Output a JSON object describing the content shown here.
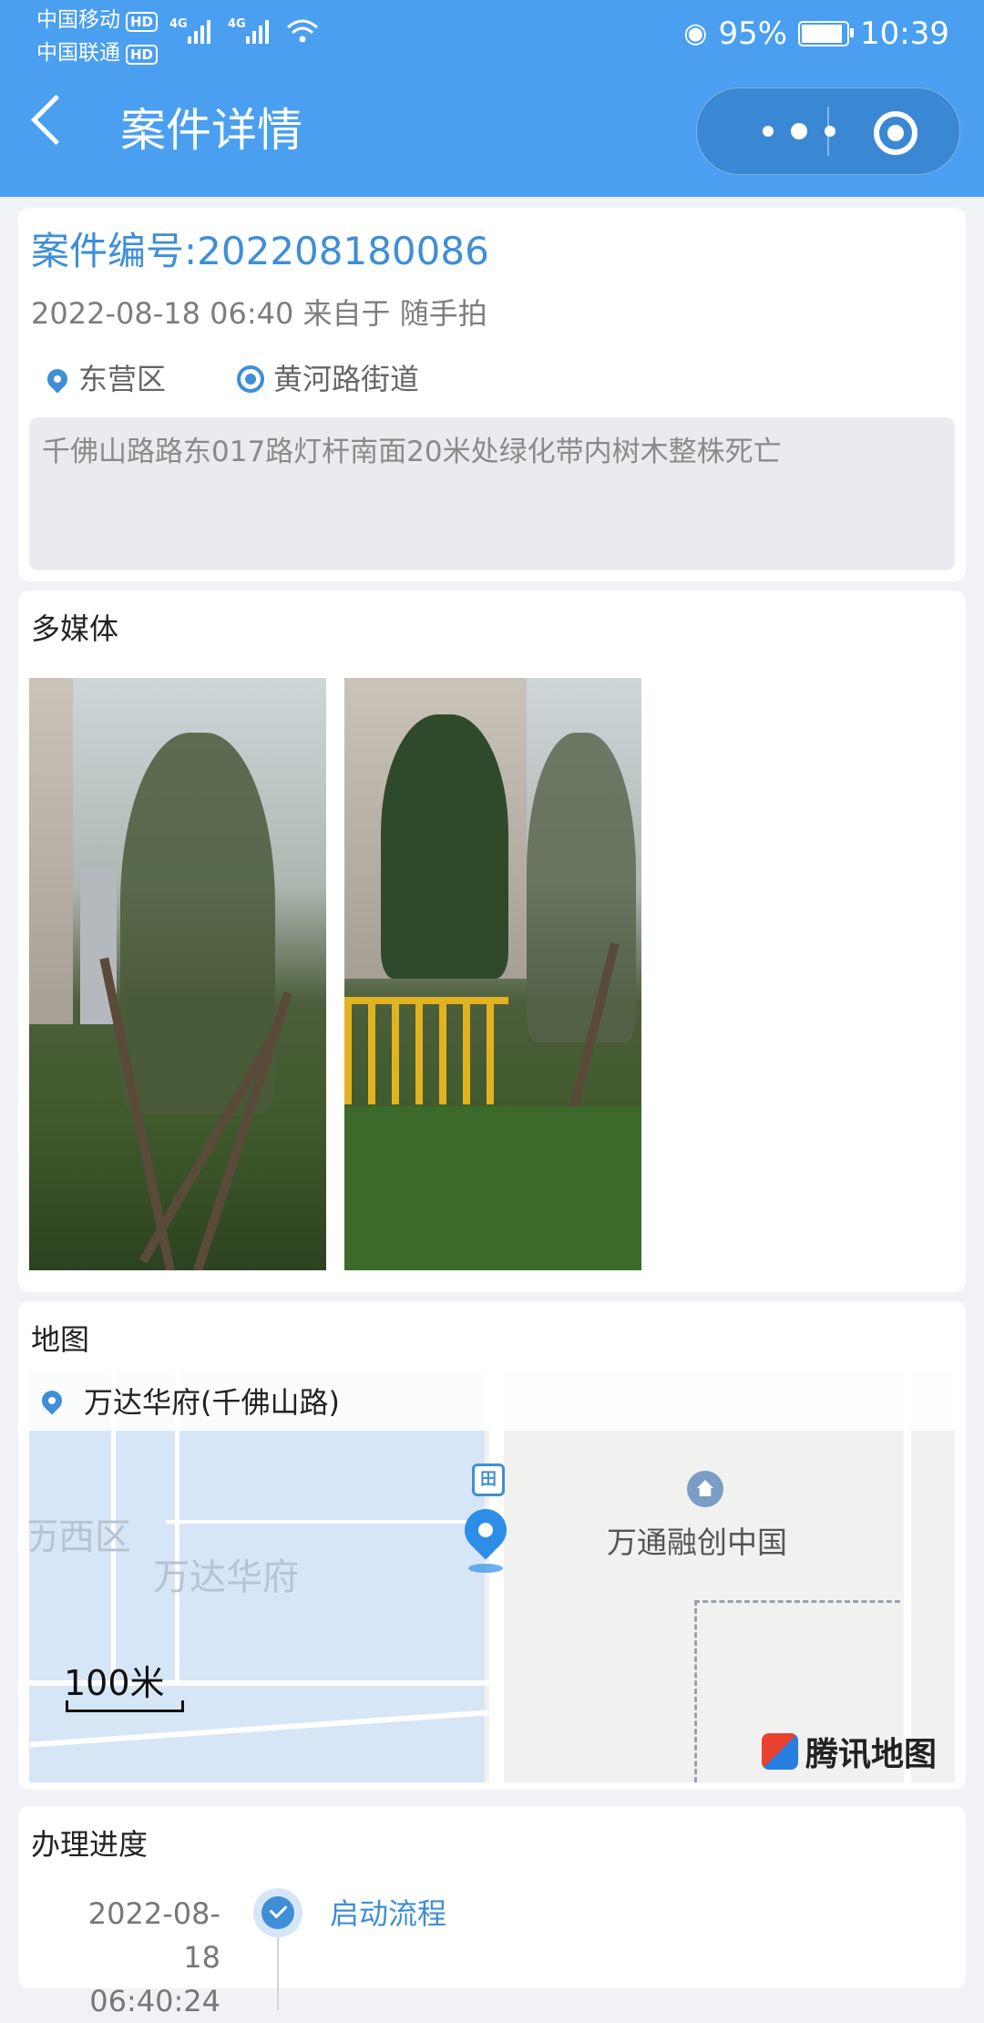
{
  "status_bar": {
    "carrier1": "中国移动",
    "carrier2": "中国联通",
    "hd": "HD",
    "net": "4G",
    "battery": "95%",
    "battery_level": 0.95,
    "time": "10:39"
  },
  "header": {
    "title": "案件详情"
  },
  "case": {
    "id_label": "案件编号:202208180086",
    "meta": "2022-08-18 06:40 来自于 随手拍",
    "district": "东营区",
    "street": "黄河路街道",
    "description": "千佛山路路东017路灯杆南面20米处绿化带内树木整株死亡"
  },
  "media": {
    "title": "多媒体"
  },
  "map": {
    "title": "地图",
    "place": "万达华府(千佛山路)",
    "labels": {
      "district_part": "历西区",
      "wanda": "万达华府",
      "poi": "万通融创中国"
    },
    "bus_glyph": "田",
    "scale": "100米",
    "provider": "腾讯地图"
  },
  "progress": {
    "title": "办理进度",
    "steps": [
      {
        "date": "2022-08-18",
        "time": "06:40:24",
        "label": "启动流程"
      }
    ]
  },
  "colors": {
    "primary": "#4a9ff0",
    "accent": "#3f8ed8"
  }
}
